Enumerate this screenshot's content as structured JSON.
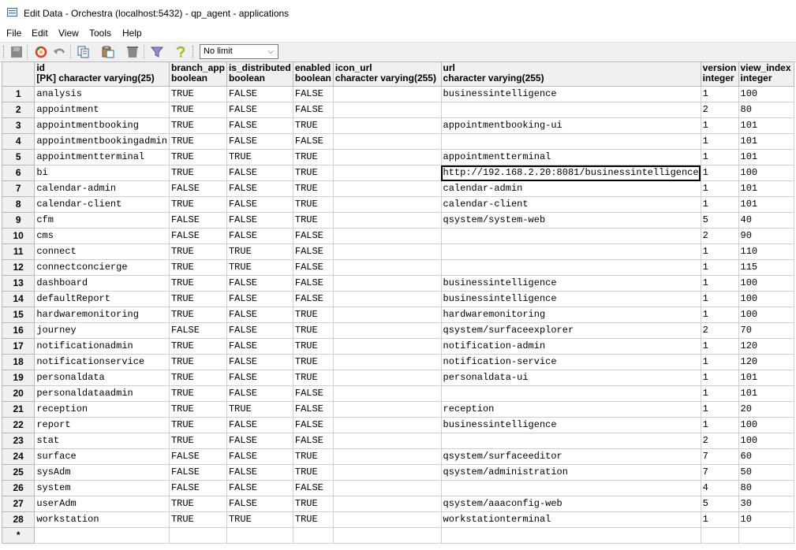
{
  "window": {
    "title": "Edit Data - Orchestra (localhost:5432) - qp_agent - applications"
  },
  "menu": [
    "File",
    "Edit",
    "View",
    "Tools",
    "Help"
  ],
  "toolbar": {
    "limit_value": "No limit"
  },
  "columns": [
    {
      "name": "id",
      "type": "[PK] character varying(25)"
    },
    {
      "name": "branch_app",
      "type": "boolean"
    },
    {
      "name": "is_distributed",
      "type": "boolean"
    },
    {
      "name": "enabled",
      "type": "boolean"
    },
    {
      "name": "icon_url",
      "type": "character varying(255)"
    },
    {
      "name": "url",
      "type": "character varying(255)"
    },
    {
      "name": "version",
      "type": "integer"
    },
    {
      "name": "view_index",
      "type": "integer"
    }
  ],
  "rows": [
    [
      "analysis",
      "TRUE",
      "FALSE",
      "FALSE",
      "",
      "businessintelligence",
      "1",
      "100"
    ],
    [
      "appointment",
      "TRUE",
      "FALSE",
      "FALSE",
      "",
      "",
      "2",
      "80"
    ],
    [
      "appointmentbooking",
      "TRUE",
      "FALSE",
      "TRUE",
      "",
      "appointmentbooking-ui",
      "1",
      "101"
    ],
    [
      "appointmentbookingadmin",
      "TRUE",
      "FALSE",
      "FALSE",
      "",
      "",
      "1",
      "101"
    ],
    [
      "appointmentterminal",
      "TRUE",
      "TRUE",
      "TRUE",
      "",
      "appointmentterminal",
      "1",
      "101"
    ],
    [
      "bi",
      "TRUE",
      "FALSE",
      "TRUE",
      "",
      "http://192.168.2.20:8081/businessintelligence",
      "1",
      "100"
    ],
    [
      "calendar-admin",
      "FALSE",
      "FALSE",
      "TRUE",
      "",
      "calendar-admin",
      "1",
      "101"
    ],
    [
      "calendar-client",
      "TRUE",
      "FALSE",
      "TRUE",
      "",
      "calendar-client",
      "1",
      "101"
    ],
    [
      "cfm",
      "FALSE",
      "FALSE",
      "TRUE",
      "",
      "qsystem/system-web",
      "5",
      "40"
    ],
    [
      "cms",
      "FALSE",
      "FALSE",
      "FALSE",
      "",
      "",
      "2",
      "90"
    ],
    [
      "connect",
      "TRUE",
      "TRUE",
      "FALSE",
      "",
      "",
      "1",
      "110"
    ],
    [
      "connectconcierge",
      "TRUE",
      "TRUE",
      "FALSE",
      "",
      "",
      "1",
      "115"
    ],
    [
      "dashboard",
      "TRUE",
      "FALSE",
      "FALSE",
      "",
      "businessintelligence",
      "1",
      "100"
    ],
    [
      "defaultReport",
      "TRUE",
      "FALSE",
      "FALSE",
      "",
      "businessintelligence",
      "1",
      "100"
    ],
    [
      "hardwaremonitoring",
      "TRUE",
      "FALSE",
      "TRUE",
      "",
      "hardwaremonitoring",
      "1",
      "100"
    ],
    [
      "journey",
      "FALSE",
      "FALSE",
      "TRUE",
      "",
      "qsystem/surfaceexplorer",
      "2",
      "70"
    ],
    [
      "notificationadmin",
      "TRUE",
      "FALSE",
      "TRUE",
      "",
      "notification-admin",
      "1",
      "120"
    ],
    [
      "notificationservice",
      "TRUE",
      "FALSE",
      "TRUE",
      "",
      "notification-service",
      "1",
      "120"
    ],
    [
      "personaldata",
      "TRUE",
      "FALSE",
      "TRUE",
      "",
      "personaldata-ui",
      "1",
      "101"
    ],
    [
      "personaldataadmin",
      "TRUE",
      "FALSE",
      "FALSE",
      "",
      "",
      "1",
      "101"
    ],
    [
      "reception",
      "TRUE",
      "TRUE",
      "FALSE",
      "",
      "reception",
      "1",
      "20"
    ],
    [
      "report",
      "TRUE",
      "FALSE",
      "FALSE",
      "",
      "businessintelligence",
      "1",
      "100"
    ],
    [
      "stat",
      "TRUE",
      "FALSE",
      "FALSE",
      "",
      "",
      "2",
      "100"
    ],
    [
      "surface",
      "FALSE",
      "FALSE",
      "TRUE",
      "",
      "qsystem/surfaceeditor",
      "7",
      "60"
    ],
    [
      "sysAdm",
      "FALSE",
      "FALSE",
      "TRUE",
      "",
      "qsystem/administration",
      "7",
      "50"
    ],
    [
      "system",
      "FALSE",
      "FALSE",
      "FALSE",
      "",
      "",
      "4",
      "80"
    ],
    [
      "userAdm",
      "TRUE",
      "FALSE",
      "TRUE",
      "",
      "qsystem/aaaconfig-web",
      "5",
      "30"
    ],
    [
      "workstation",
      "TRUE",
      "TRUE",
      "TRUE",
      "",
      "workstationterminal",
      "1",
      "10"
    ]
  ],
  "new_row_marker": "*",
  "selected_cell": {
    "row": 6,
    "col": "url"
  }
}
